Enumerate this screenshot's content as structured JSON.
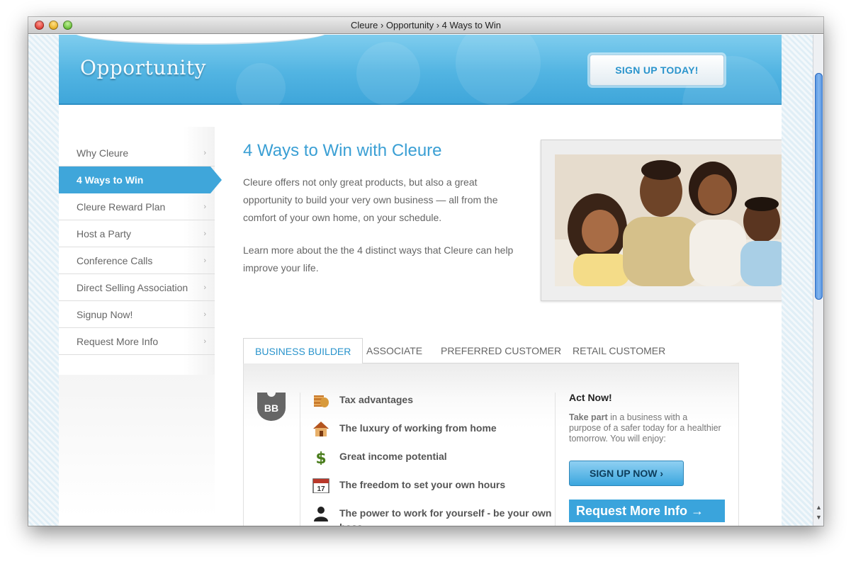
{
  "window": {
    "title": "Cleure › Opportunity › 4 Ways to Win"
  },
  "hero": {
    "title": "Opportunity",
    "signup_label": "SIGN UP TODAY!"
  },
  "sidebar": {
    "items": [
      {
        "label": "Why Cleure",
        "chev": "›"
      },
      {
        "label": "4 Ways to Win",
        "chev": ""
      },
      {
        "label": "Cleure Reward Plan",
        "chev": "›"
      },
      {
        "label": "Host a Party",
        "chev": "›"
      },
      {
        "label": "Conference Calls",
        "chev": "›"
      },
      {
        "label": "Direct Selling Association",
        "chev": "›"
      },
      {
        "label": "Signup Now!",
        "chev": "›"
      },
      {
        "label": "Request More Info",
        "chev": "›"
      }
    ]
  },
  "main": {
    "title": "4 Ways to Win with Cleure",
    "para1": "Cleure offers not only great products, but also a great opportunity to build your very own business — all from the comfort of your own home, on your schedule.",
    "para2": "Learn more about the the 4 distinct ways that Cleure can help improve your life."
  },
  "tabs": [
    {
      "label": "BUSINESS BUILDER",
      "active": true
    },
    {
      "label": "ASSOCIATE",
      "active": false
    },
    {
      "label": "PREFERRED CUSTOMER",
      "active": false
    },
    {
      "label": "RETAIL CUSTOMER",
      "active": false
    }
  ],
  "panel": {
    "badge": "BB",
    "features": [
      {
        "label": "Tax advantages",
        "icon": "coins-icon"
      },
      {
        "label": "The luxury of working from home",
        "icon": "house-icon"
      },
      {
        "label": "Great income potential",
        "icon": "dollar-icon"
      },
      {
        "label": "The freedom to set your own hours",
        "icon": "calendar-icon"
      },
      {
        "label": "The power to work for yourself - be your own boss",
        "icon": "person-icon"
      }
    ],
    "calendar_day": "17",
    "act_title": "Act Now!",
    "act_lead": "Take part",
    "act_rest": " in a business with a purpose of a safer today for a healthier tomorrow. You will enjoy:",
    "signup_now": "SIGN UP NOW ›",
    "request_info": "Request More Info →"
  },
  "scrollbar": {
    "up": "▲",
    "down": "▼"
  },
  "colors": {
    "accent": "#3fa6da",
    "hero": "#52b4e2",
    "text": "#666666"
  }
}
